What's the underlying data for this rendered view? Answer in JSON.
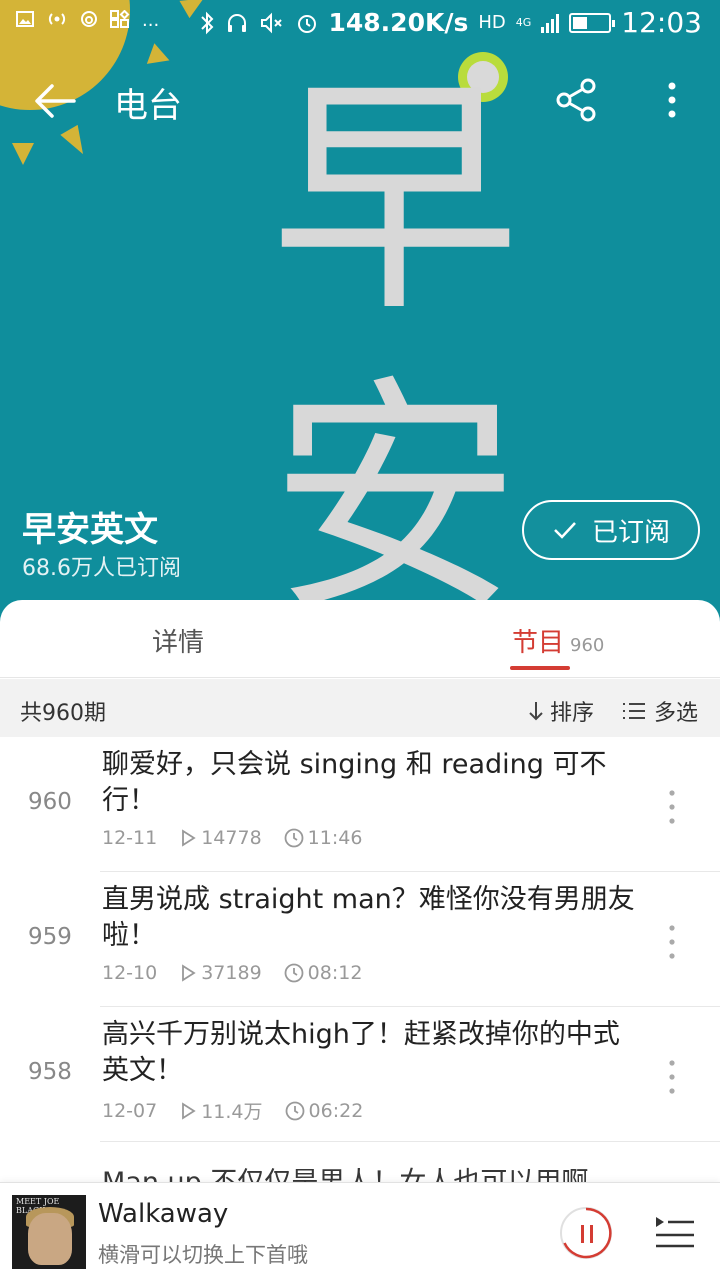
{
  "status_bar": {
    "net_speed": "148.20K/s",
    "network": "HD",
    "cell_label": "4G",
    "time": "12:03",
    "battery_level": 0.4,
    "more_label": "..."
  },
  "toolbar": {
    "title": "电台"
  },
  "cover": {
    "char_1": "早",
    "char_2": "安"
  },
  "program": {
    "name": "早安英文",
    "subscribers": "68.6万人已订阅",
    "subscribe_label": "已订阅"
  },
  "tabs": {
    "details": "详情",
    "episodes": "节目",
    "episodes_count": "960"
  },
  "list_header": {
    "total": "共960期",
    "sort": "排序",
    "multi_select": "多选"
  },
  "episodes": [
    {
      "number": "960",
      "title": "聊爱好，只会说 singing 和 reading 可不行！",
      "date": "12-11",
      "plays": "14778",
      "duration": "11:46"
    },
    {
      "number": "959",
      "title": "直男说成 straight man？难怪你没有男朋友啦！",
      "date": "12-10",
      "plays": "37189",
      "duration": "08:12"
    },
    {
      "number": "958",
      "title": "高兴千万别说太high了！赶紧改掉你的中式英文！",
      "date": "12-07",
      "plays": "11.4万",
      "duration": "06:22"
    }
  ],
  "peek_episode": {
    "title": "Man up 不仅仅是男人！女人也可以用啊"
  },
  "player": {
    "track": "Walkaway",
    "hint": "横滑可以切换上下首哦",
    "album_text": "MEET JOE BLACK"
  },
  "colors": {
    "cover_bg": "#0f8e9c",
    "accent": "#d43c33",
    "sun": "#d4b437"
  }
}
